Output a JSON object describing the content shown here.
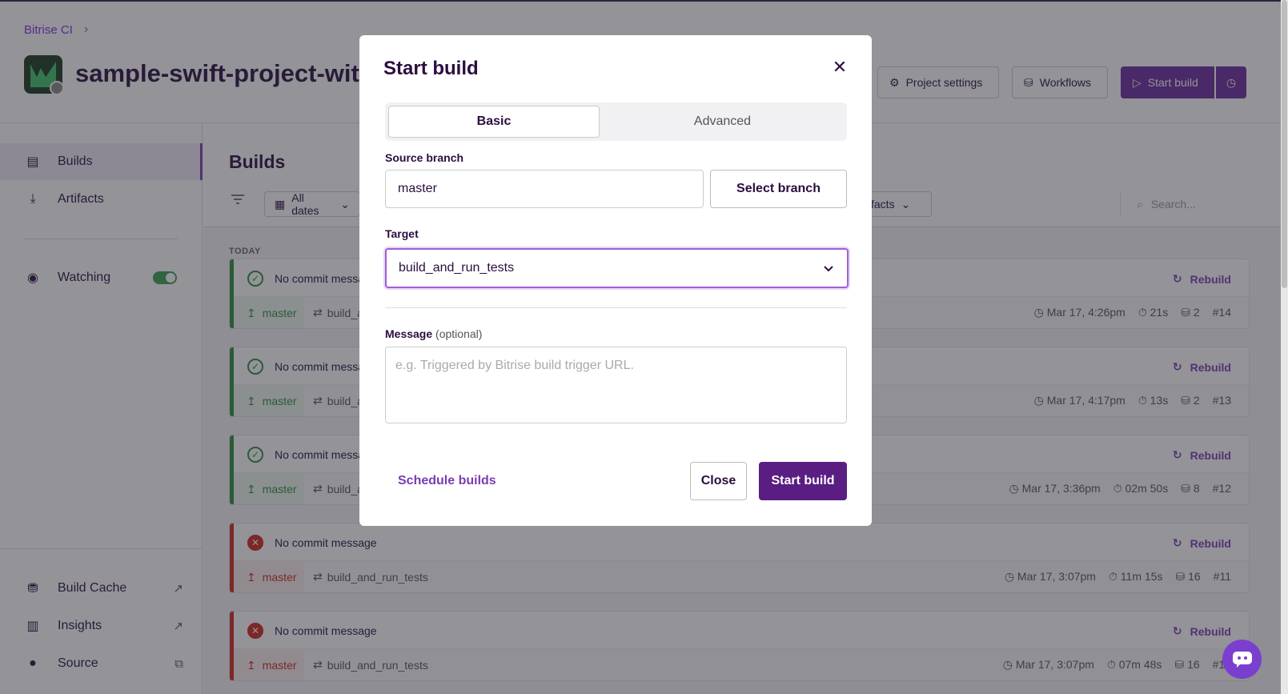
{
  "breadcrumb": {
    "root": "Bitrise CI"
  },
  "project": {
    "title": "sample-swift-project-with-parallel-ui-tests"
  },
  "header_buttons": {
    "project_settings": "Project settings",
    "workflows": "Workflows",
    "start_build": "Start build"
  },
  "sidebar": {
    "builds": "Builds",
    "artifacts": "Artifacts",
    "watching": "Watching",
    "build_cache": "Build Cache",
    "insights": "Insights",
    "source": "Source"
  },
  "main": {
    "title": "Builds",
    "all_dates": "All dates",
    "artifacts_filter": "Artifacts",
    "search_placeholder": "Search...",
    "today": "TODAY",
    "rebuild": "Rebuild"
  },
  "builds": [
    {
      "message": "No commit message",
      "branch": "master",
      "workflow": "build_and_run_tests",
      "date": "Mar 17, 4:26pm",
      "duration": "21s",
      "count": "2",
      "number": "#14",
      "status": "success"
    },
    {
      "message": "No commit message",
      "branch": "master",
      "workflow": "build_and_run_tests",
      "date": "Mar 17, 4:17pm",
      "duration": "13s",
      "count": "2",
      "number": "#13",
      "status": "success"
    },
    {
      "message": "No commit message",
      "branch": "master",
      "workflow": "build_and_run_tests",
      "date": "Mar 17, 3:36pm",
      "duration": "02m 50s",
      "count": "8",
      "number": "#12",
      "status": "success"
    },
    {
      "message": "No commit message",
      "branch": "master",
      "workflow": "build_and_run_tests",
      "date": "Mar 17, 3:07pm",
      "duration": "11m 15s",
      "count": "16",
      "number": "#11",
      "status": "failed"
    },
    {
      "message": "No commit message",
      "branch": "master",
      "workflow": "build_and_run_tests",
      "date": "Mar 17, 3:07pm",
      "duration": "07m 48s",
      "count": "16",
      "number": "#10",
      "status": "failed"
    }
  ],
  "modal": {
    "title": "Start build",
    "tabs": [
      "Basic",
      "Advanced"
    ],
    "source_branch_label": "Source branch",
    "source_branch_value": "master",
    "select_branch": "Select branch",
    "target_label": "Target",
    "target_value": "build_and_run_tests",
    "message_label": "Message",
    "message_optional": "(optional)",
    "message_placeholder": "e.g. Triggered by Bitrise build trigger URL.",
    "schedule_builds": "Schedule builds",
    "close": "Close",
    "start_build": "Start build"
  },
  "colors": {
    "accent": "#5a1e82",
    "success": "#2f8f3e",
    "failed": "#d0281e"
  }
}
